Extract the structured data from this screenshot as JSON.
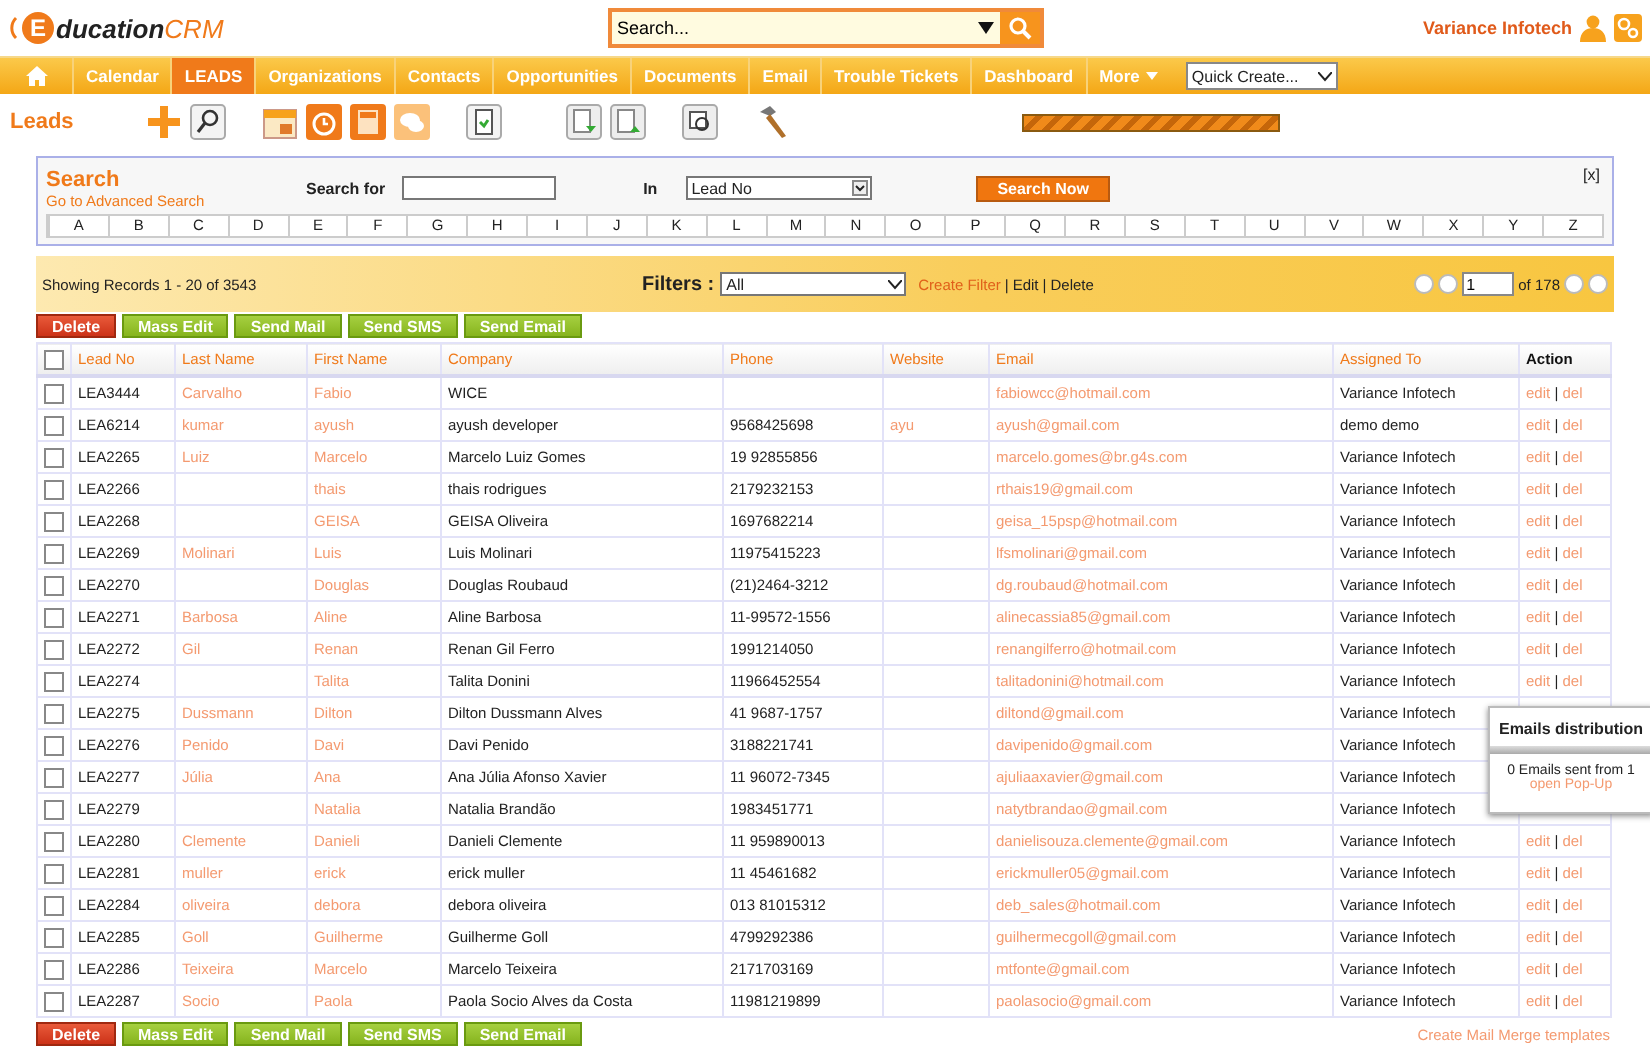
{
  "header": {
    "logo_initial": "E",
    "logo_text": "ducation",
    "logo_suffix": "CRM",
    "search": {
      "value": "Search..."
    },
    "user": "Variance Infotech"
  },
  "nav": {
    "items": [
      {
        "label": "Calendar",
        "selected": false
      },
      {
        "label": "LEADS",
        "selected": true
      },
      {
        "label": "Organizations",
        "selected": false
      },
      {
        "label": "Contacts",
        "selected": false
      },
      {
        "label": "Opportunities",
        "selected": false
      },
      {
        "label": "Documents",
        "selected": false
      },
      {
        "label": "Email",
        "selected": false
      },
      {
        "label": "Trouble Tickets",
        "selected": false
      },
      {
        "label": "Dashboard",
        "selected": false
      },
      {
        "label": "More",
        "selected": false
      }
    ],
    "quick_create": "Quick Create..."
  },
  "page_title": "Leads",
  "search_panel": {
    "title": "Search",
    "advanced_link": "Go to Advanced Search",
    "search_for_label": "Search for",
    "in_label": "In",
    "in_value": "Lead No",
    "button": "Search Now",
    "close": "[x]",
    "letters": [
      "A",
      "B",
      "C",
      "D",
      "E",
      "F",
      "G",
      "H",
      "I",
      "J",
      "K",
      "L",
      "M",
      "N",
      "O",
      "P",
      "Q",
      "R",
      "S",
      "T",
      "U",
      "V",
      "W",
      "X",
      "Y",
      "Z"
    ]
  },
  "records_bar": {
    "showing": "Showing Records 1 - 20 of 3543",
    "filters_label": "Filters :",
    "filter_value": "All",
    "create_filter": "Create Filter",
    "separator": "|",
    "edit": "Edit",
    "delete": "Delete",
    "page": "1",
    "of_pages": "of 178"
  },
  "action_buttons": [
    {
      "label": "Delete",
      "kind": "danger"
    },
    {
      "label": "Mass Edit",
      "kind": "normal"
    },
    {
      "label": "Send Mail",
      "kind": "normal"
    },
    {
      "label": "Send SMS",
      "kind": "normal"
    },
    {
      "label": "Send Email",
      "kind": "normal"
    }
  ],
  "table": {
    "select_all_checked": false,
    "action_separator": "|",
    "columns": [
      "Lead No",
      "Last Name",
      "First Name",
      "Company",
      "Phone",
      "Website",
      "Email",
      "Assigned To",
      "Action"
    ],
    "rows": [
      {
        "lead_no": "LEA3444",
        "last_name": "Carvalho",
        "first_name": "Fabio",
        "company": "WICE",
        "phone": "",
        "website": "",
        "email": "fabiowcc@hotmail.com",
        "assigned_to": "Variance Infotech",
        "actions": [
          "edit",
          "del"
        ],
        "checked": false
      },
      {
        "lead_no": "LEA6214",
        "last_name": "kumar",
        "first_name": "ayush",
        "company": "ayush developer",
        "phone": "9568425698",
        "website": "ayu",
        "email": "ayush@gmail.com",
        "assigned_to": "demo demo",
        "actions": [
          "edit",
          "del"
        ],
        "checked": false
      },
      {
        "lead_no": "LEA2265",
        "last_name": "Luiz",
        "first_name": "Marcelo",
        "company": "Marcelo Luiz Gomes",
        "phone": "19 92855856",
        "website": "",
        "email": "marcelo.gomes@br.g4s.com",
        "assigned_to": "Variance Infotech",
        "actions": [
          "edit",
          "del"
        ],
        "checked": false
      },
      {
        "lead_no": "LEA2266",
        "last_name": "",
        "first_name": "thais",
        "company": "thais rodrigues",
        "phone": "2179232153",
        "website": "",
        "email": "rthais19@gmail.com",
        "assigned_to": "Variance Infotech",
        "actions": [
          "edit",
          "del"
        ],
        "checked": false
      },
      {
        "lead_no": "LEA2268",
        "last_name": "",
        "first_name": "GEISA",
        "company": "GEISA Oliveira",
        "phone": "1697682214",
        "website": "",
        "email": "geisa_15psp@hotmail.com",
        "assigned_to": "Variance Infotech",
        "actions": [
          "edit",
          "del"
        ],
        "checked": false
      },
      {
        "lead_no": "LEA2269",
        "last_name": "Molinari",
        "first_name": "Luis",
        "company": "Luis Molinari",
        "phone": "11975415223",
        "website": "",
        "email": "lfsmolinari@gmail.com",
        "assigned_to": "Variance Infotech",
        "actions": [
          "edit",
          "del"
        ],
        "checked": false
      },
      {
        "lead_no": "LEA2270",
        "last_name": "",
        "first_name": "Douglas",
        "company": "Douglas Roubaud",
        "phone": "(21)2464-3212",
        "website": "",
        "email": "dg.roubaud@hotmail.com",
        "assigned_to": "Variance Infotech",
        "actions": [
          "edit",
          "del"
        ],
        "checked": false
      },
      {
        "lead_no": "LEA2271",
        "last_name": "Barbosa",
        "first_name": "Aline",
        "company": "Aline Barbosa",
        "phone": "11-99572-1556",
        "website": "",
        "email": "alinecassia85@gmail.com",
        "assigned_to": "Variance Infotech",
        "actions": [
          "edit",
          "del"
        ],
        "checked": false
      },
      {
        "lead_no": "LEA2272",
        "last_name": "Gil",
        "first_name": "Renan",
        "company": "Renan Gil Ferro",
        "phone": "1991214050",
        "website": "",
        "email": "renangilferro@hotmail.com",
        "assigned_to": "Variance Infotech",
        "actions": [
          "edit",
          "del"
        ],
        "checked": false
      },
      {
        "lead_no": "LEA2274",
        "last_name": "",
        "first_name": "Talita",
        "company": "Talita Donini",
        "phone": "11966452554",
        "website": "",
        "email": "talitadonini@hotmail.com",
        "assigned_to": "Variance Infotech",
        "actions": [
          "edit",
          "del"
        ],
        "checked": false
      },
      {
        "lead_no": "LEA2275",
        "last_name": "Dussmann",
        "first_name": "Dilton",
        "company": "Dilton Dussmann Alves",
        "phone": "41 9687-1757",
        "website": "",
        "email": "diltond@gmail.com",
        "assigned_to": "Variance Infotech",
        "checked": false
      },
      {
        "lead_no": "LEA2276",
        "last_name": "Penido",
        "first_name": "Davi",
        "company": "Davi Penido",
        "phone": "3188221741",
        "website": "",
        "email": "davipenido@gmail.com",
        "assigned_to": "Variance Infotech",
        "checked": false
      },
      {
        "lead_no": "LEA2277",
        "last_name": "Júlia",
        "first_name": "Ana",
        "company": "Ana Júlia Afonso Xavier",
        "phone": "11 96072-7345",
        "website": "",
        "email": "ajuliaaxavier@gmail.com",
        "assigned_to": "Variance Infotech",
        "checked": false
      },
      {
        "lead_no": "LEA2279",
        "last_name": "",
        "first_name": "Natalia",
        "company": "Natalia Brandão",
        "phone": "1983451771",
        "website": "",
        "email": "natytbrandao@gmail.com",
        "assigned_to": "Variance Infotech",
        "checked": false
      },
      {
        "lead_no": "LEA2280",
        "last_name": "Clemente",
        "first_name": "Danieli",
        "company": "Danieli Clemente",
        "phone": "11 959890013",
        "website": "",
        "email": "danielisouza.clemente@gmail.com",
        "assigned_to": "Variance Infotech",
        "actions": [
          "edit",
          "del"
        ],
        "checked": false
      },
      {
        "lead_no": "LEA2281",
        "last_name": "muller",
        "first_name": "erick",
        "company": "erick muller",
        "phone": "11 45461682",
        "website": "",
        "email": "erickmuller05@gmail.com",
        "assigned_to": "Variance Infotech",
        "actions": [
          "edit",
          "del"
        ],
        "checked": false
      },
      {
        "lead_no": "LEA2284",
        "last_name": "oliveira",
        "first_name": "debora",
        "company": "debora oliveira",
        "phone": "013 81015312",
        "website": "",
        "email": "deb_sales@hotmail.com",
        "assigned_to": "Variance Infotech",
        "actions": [
          "edit",
          "del"
        ],
        "checked": false
      },
      {
        "lead_no": "LEA2285",
        "last_name": "Goll",
        "first_name": "Guilherme",
        "company": "Guilherme Goll",
        "phone": "4799292386",
        "website": "",
        "email": "guilhermecgoll@gmail.com",
        "assigned_to": "Variance Infotech",
        "actions": [
          "edit",
          "del"
        ],
        "checked": false
      },
      {
        "lead_no": "LEA2286",
        "last_name": "Teixeira",
        "first_name": "Marcelo",
        "company": "Marcelo Teixeira",
        "phone": "2171703169",
        "website": "",
        "email": "mtfonte@gmail.com",
        "assigned_to": "Variance Infotech",
        "actions": [
          "edit",
          "del"
        ],
        "checked": false
      },
      {
        "lead_no": "LEA2287",
        "last_name": "Socio",
        "first_name": "Paola",
        "company": "Paola Socio Alves da Costa",
        "phone": "11981219899",
        "website": "",
        "email": "paolasocio@gmail.com",
        "assigned_to": "Variance Infotech",
        "actions": [
          "edit",
          "del"
        ],
        "checked": false
      }
    ]
  },
  "bottom_buttons": [
    {
      "label": "Delete",
      "kind": "danger"
    },
    {
      "label": "Mass Edit",
      "kind": "normal"
    },
    {
      "label": "Send Mail",
      "kind": "normal"
    },
    {
      "label": "Send SMS",
      "kind": "normal"
    },
    {
      "label": "Send Email",
      "kind": "normal"
    }
  ],
  "mail_merge_link": "Create Mail Merge templates",
  "email_popup": {
    "title": "Emails distribution",
    "status": "0 Emails sent from 1",
    "link": "open Pop-Up"
  }
}
